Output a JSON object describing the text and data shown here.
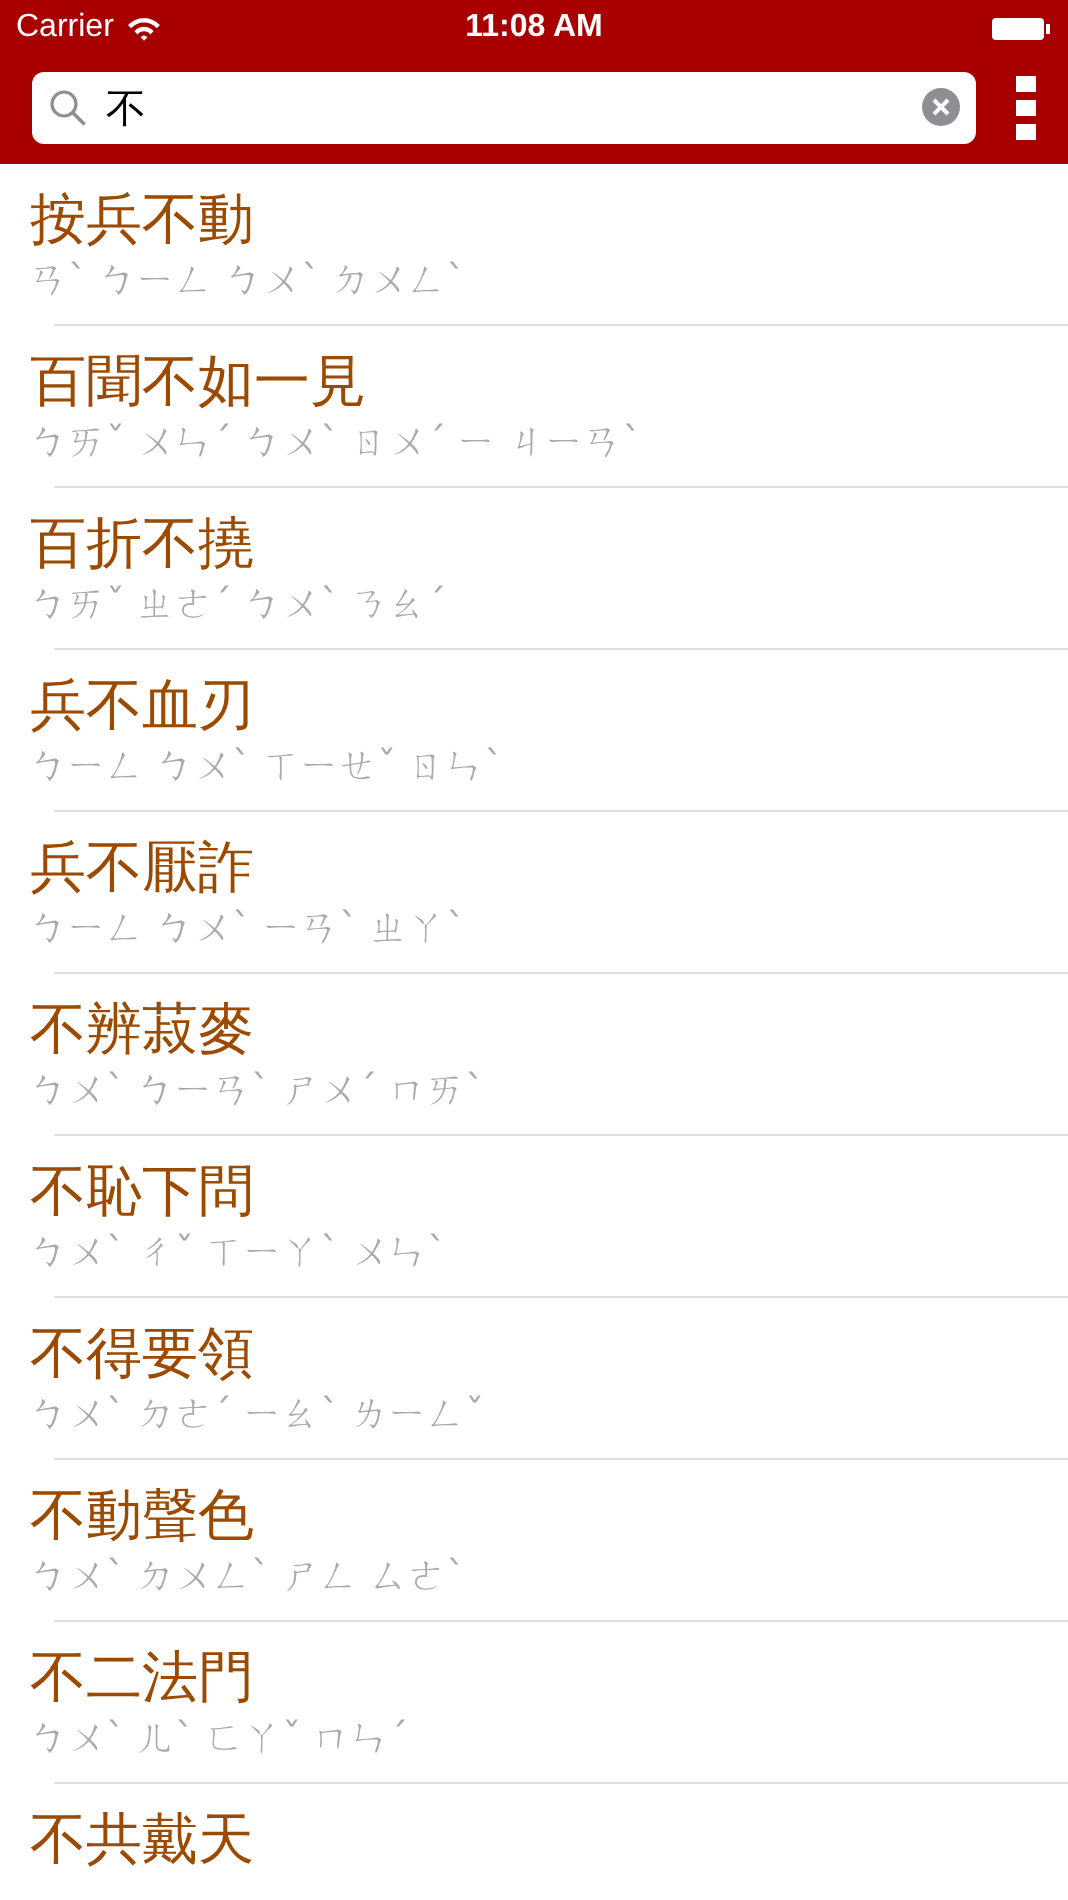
{
  "status_bar": {
    "carrier": "Carrier",
    "time": "11:08 AM"
  },
  "search": {
    "value": "不"
  },
  "results": [
    {
      "word": "按兵不動",
      "zhuyin": "ㄢˋ ㄅㄧㄥ ㄅㄨˋ ㄉㄨㄥˋ"
    },
    {
      "word": "百聞不如一見",
      "zhuyin": "ㄅㄞˇ ㄨㄣˊ ㄅㄨˋ ㄖㄨˊ ㄧ ㄐㄧㄢˋ"
    },
    {
      "word": "百折不撓",
      "zhuyin": "ㄅㄞˇ ㄓㄜˊ ㄅㄨˋ ㄋㄠˊ"
    },
    {
      "word": "兵不血刃",
      "zhuyin": "ㄅㄧㄥ ㄅㄨˋ ㄒㄧㄝˇ ㄖㄣˋ"
    },
    {
      "word": "兵不厭詐",
      "zhuyin": "ㄅㄧㄥ ㄅㄨˋ ㄧㄢˋ ㄓㄚˋ"
    },
    {
      "word": "不辨菽麥",
      "zhuyin": "ㄅㄨˋ ㄅㄧㄢˋ ㄕㄨˊ ㄇㄞˋ"
    },
    {
      "word": "不恥下問",
      "zhuyin": "ㄅㄨˋ ㄔˇ ㄒㄧㄚˋ ㄨㄣˋ"
    },
    {
      "word": "不得要領",
      "zhuyin": "ㄅㄨˋ ㄉㄜˊ ㄧㄠˋ ㄌㄧㄥˇ"
    },
    {
      "word": "不動聲色",
      "zhuyin": "ㄅㄨˋ ㄉㄨㄥˋ ㄕㄥ ㄙㄜˋ"
    },
    {
      "word": "不二法門",
      "zhuyin": "ㄅㄨˋ ㄦˋ ㄈㄚˇ ㄇㄣˊ"
    },
    {
      "word": "不共戴天"
    }
  ]
}
